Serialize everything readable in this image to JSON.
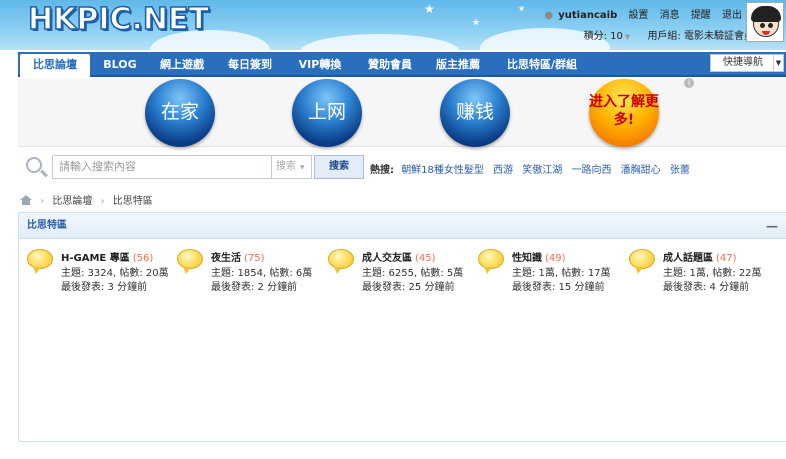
{
  "header": {
    "logo_text": "HKPIC.NET",
    "username": "yutiancaib",
    "links": [
      "設置",
      "消息",
      "提醒",
      "退出"
    ],
    "credits": "積分: 10",
    "user_group": "用戶組: 電影未驗証會員"
  },
  "nav": {
    "tabs": [
      "比思論壇",
      "BLOG",
      "網上遊戲",
      "每日簽到",
      "VIP轉換",
      "贊助會員",
      "版主推薦",
      "比思特區/群組"
    ],
    "quick_nav": "快捷導航"
  },
  "banner": {
    "buttons": [
      "在家",
      "上网",
      "赚钱",
      "进入了解更多!"
    ]
  },
  "search": {
    "placeholder": "請輸入搜索內容",
    "type": "搜索",
    "button": "搜索",
    "hot_label": "熱搜:",
    "hot_keywords": [
      "朝鮮18種女性髮型",
      "西游",
      "笑傲江湖",
      "一路向西",
      "潘胸甜心",
      "张蕾"
    ]
  },
  "breadcrumb": {
    "items": [
      "比思論壇",
      "比思特區"
    ]
  },
  "section": {
    "title": "比思特區",
    "collapse": "—",
    "forums": [
      {
        "name": "H-GAME 專區",
        "count": "(56)",
        "stats": "主題: 3324, 帖數: 20萬",
        "last": "最後發表: 3 分鐘前"
      },
      {
        "name": "夜生活",
        "count": "(75)",
        "stats": "主題: 1854, 帖數: 6萬",
        "last": "最後發表: 2 分鐘前"
      },
      {
        "name": "成人交友區",
        "count": "(45)",
        "stats": "主題: 6255, 帖數: 5萬",
        "last": "最後發表: 25 分鐘前"
      },
      {
        "name": "性知識",
        "count": "(49)",
        "stats": "主題: 1萬, 帖數: 17萬",
        "last": "最後發表: 15 分鐘前"
      },
      {
        "name": "成人話題區",
        "count": "(47)",
        "stats": "主題: 1萬, 帖數: 22萬",
        "last": "最後發表: 4 分鐘前"
      }
    ]
  }
}
